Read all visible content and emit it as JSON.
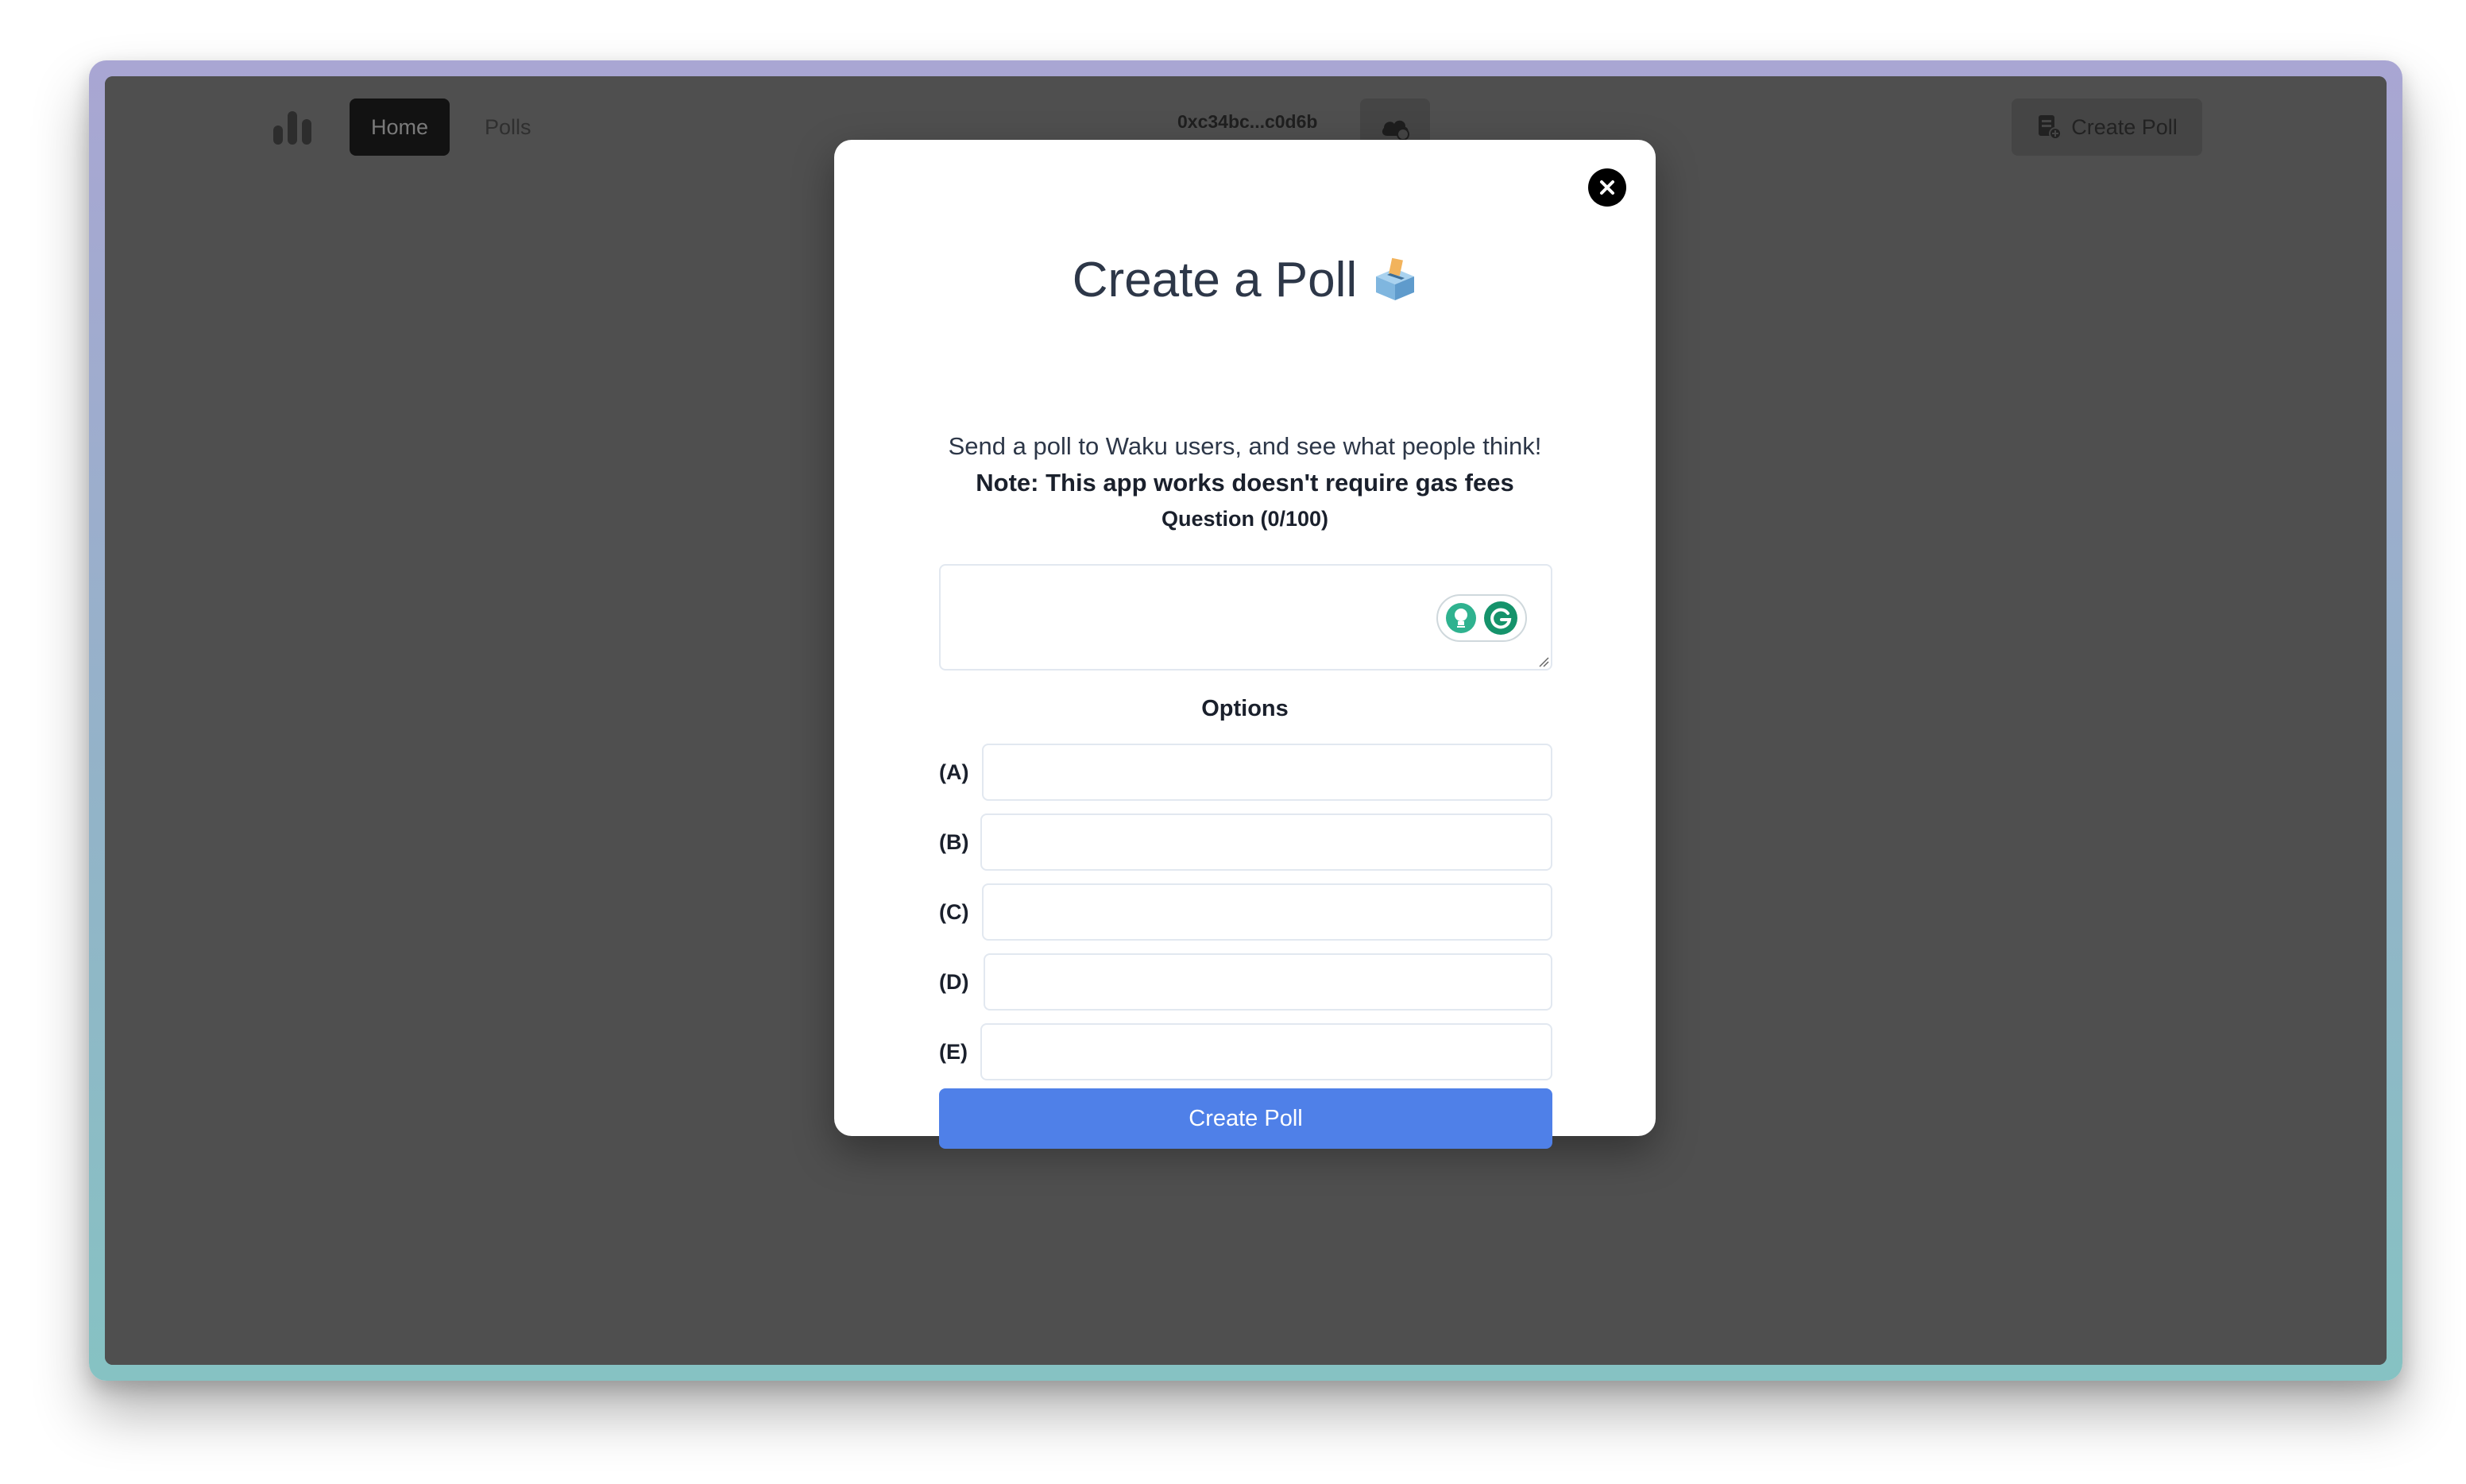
{
  "nav": {
    "home_label": "Home",
    "polls_label": "Polls",
    "wallet_address": "0xc34bc...c0d6b",
    "create_poll_label": "Create Poll"
  },
  "modal": {
    "title": "Create a Poll",
    "title_emoji": "ballot-box-icon",
    "subtitle": "Send a poll to Waku users, and see what people think!",
    "note": "Note: This app works doesn't require gas fees",
    "question_label": "Question (0/100)",
    "question_value": "",
    "options_label": "Options",
    "options": [
      {
        "letter": "(A)",
        "value": ""
      },
      {
        "letter": "(B)",
        "value": ""
      },
      {
        "letter": "(C)",
        "value": ""
      },
      {
        "letter": "(D)",
        "value": ""
      },
      {
        "letter": "(E)",
        "value": ""
      }
    ],
    "submit_label": "Create Poll"
  },
  "colors": {
    "primary": "#4f80e8",
    "overlay": "#4f4f4f",
    "heading": "#2d3748"
  }
}
